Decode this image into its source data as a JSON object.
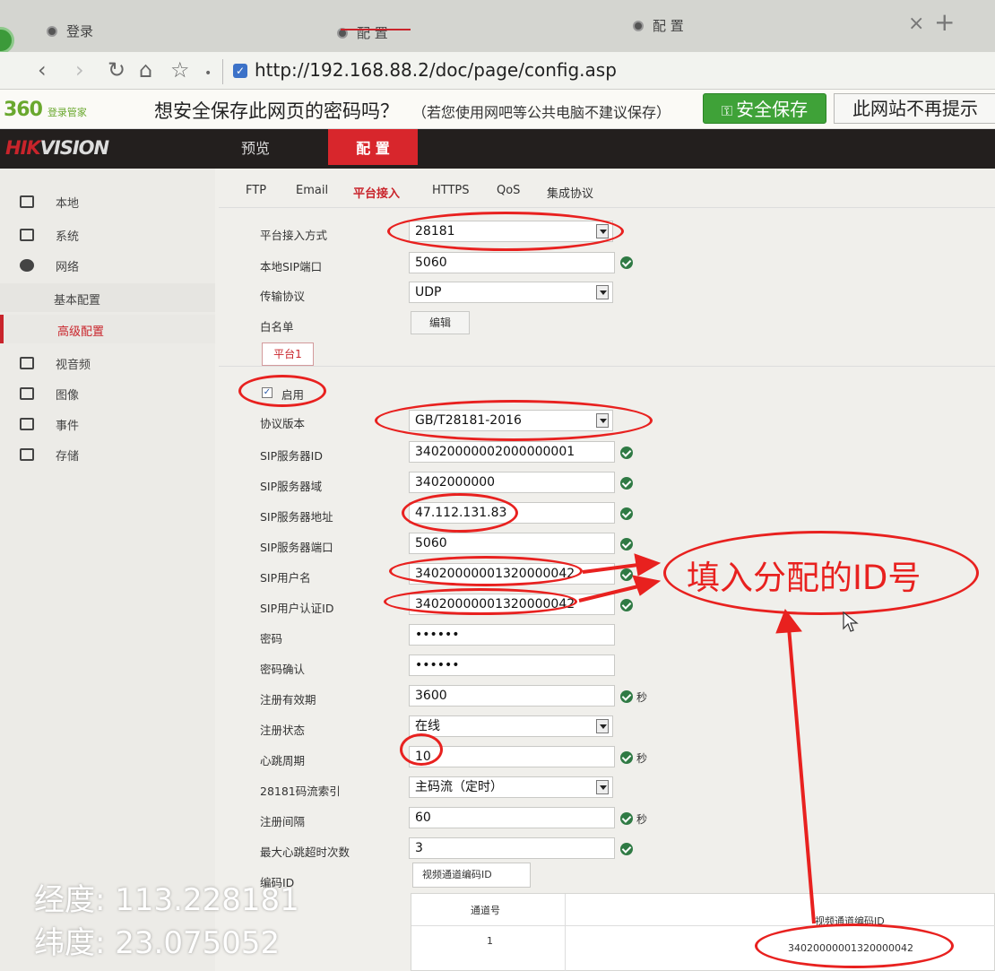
{
  "browser": {
    "tabs": [
      "登录",
      "配 置",
      "配 置"
    ],
    "close_glyph": "×",
    "new_tab_glyph": "+",
    "url": "http://192.168.88.2/doc/page/config.asp"
  },
  "password_bar": {
    "brand": "360",
    "brand_sub": "登录管家",
    "question": "想安全保存此网页的密码吗？",
    "note": "（若您使用网吧等公共电脑不建议保存）",
    "save_label": "安全保存",
    "never_label": "此网站不再提示"
  },
  "app": {
    "logo_red": "HIK",
    "logo_rest": "VISION",
    "nav": [
      "预览",
      "配 置"
    ]
  },
  "sidebar": {
    "items": [
      "本地",
      "系统",
      "网络",
      "视音频",
      "图像",
      "事件",
      "存储"
    ],
    "sub_items": [
      "基本配置",
      "高级配置"
    ]
  },
  "tabs": [
    "FTP",
    "Email",
    "平台接入",
    "HTTPS",
    "QoS",
    "集成协议"
  ],
  "form": {
    "access_mode_label": "平台接入方式",
    "access_mode_value": "28181",
    "sip_port_label": "本地SIP端口",
    "sip_port_value": "5060",
    "transport_label": "传输协议",
    "transport_value": "UDP",
    "whitelist_label": "白名单",
    "edit_label": "编辑",
    "platform_tab": "平台1",
    "enable_label": "启用",
    "check_glyph": "✓",
    "protocol_version_label": "协议版本",
    "protocol_version_value": "GB/T28181-2016",
    "server_id_label": "SIP服务器ID",
    "server_id_value": "34020000002000000001",
    "server_domain_label": "SIP服务器域",
    "server_domain_value": "3402000000",
    "server_addr_label": "SIP服务器地址",
    "server_addr_value": "47.112.131.83",
    "server_port_label": "SIP服务器端口",
    "server_port_value": "5060",
    "username_label": "SIP用户名",
    "username_value": "34020000001320000042",
    "auth_id_label": "SIP用户认证ID",
    "auth_id_value": "34020000001320000042",
    "password_label": "密码",
    "password_value": "••••••",
    "password_confirm_label": "密码确认",
    "password_confirm_value": "••••••",
    "expiry_label": "注册有效期",
    "expiry_value": "3600",
    "seconds": "秒",
    "status_label": "注册状态",
    "status_value": "在线",
    "heartbeat_label": "心跳周期",
    "heartbeat_value": "10",
    "stream_index_label": "28181码流索引",
    "stream_index_value": "主码流（定时）",
    "reg_interval_label": "注册间隔",
    "reg_interval_value": "60",
    "max_timeout_label": "最大心跳超时次数",
    "max_timeout_value": "3",
    "encoding_id_label": "编码ID",
    "encoding_tab": "视频通道编码ID",
    "table_header_channel": "通道号",
    "table_header_id": "视频通道编码ID",
    "row_channel": "1",
    "row_id": "34020000001320000042"
  },
  "annotation": {
    "text": "填入分配的ID号",
    "color": "#e8211f"
  },
  "watermark": {
    "longitude": "经度: 113.228181",
    "latitude": "纬度: 23.075052"
  },
  "colors": {
    "accent_red": "#c9242b",
    "save_green": "#3fa238",
    "ok_green": "#2f7a44"
  }
}
